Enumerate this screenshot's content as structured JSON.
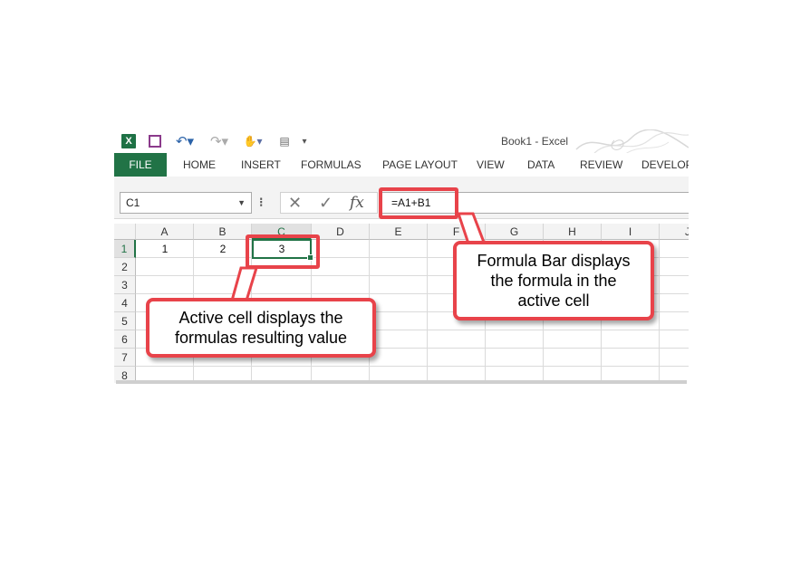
{
  "window": {
    "title": "Book1 - Excel"
  },
  "qat": {
    "excel_icon": "X"
  },
  "ribbon": {
    "tabs": [
      {
        "label": "FILE"
      },
      {
        "label": "HOME"
      },
      {
        "label": "INSERT"
      },
      {
        "label": "FORMULAS"
      },
      {
        "label": "PAGE LAYOUT"
      },
      {
        "label": "VIEW"
      },
      {
        "label": "DATA"
      },
      {
        "label": "REVIEW"
      },
      {
        "label": "DEVELOP"
      }
    ]
  },
  "formula_row": {
    "name_box": "C1",
    "formula": "=A1+B1",
    "fx_label": "fx"
  },
  "grid": {
    "columns": [
      "A",
      "B",
      "C",
      "D",
      "E",
      "F",
      "G",
      "H",
      "I",
      "J"
    ],
    "rows": [
      "1",
      "2",
      "3",
      "4",
      "5",
      "6",
      "7",
      "8"
    ],
    "cells": {
      "A1": "1",
      "B1": "2",
      "C1": "3"
    }
  },
  "callouts": {
    "formula_bar": "Formula Bar displays\nthe formula in the\nactive cell",
    "active_cell": "Active cell displays the\nformulas resulting value"
  },
  "colors": {
    "accent": "#217346",
    "callout_border": "#e8434a"
  }
}
